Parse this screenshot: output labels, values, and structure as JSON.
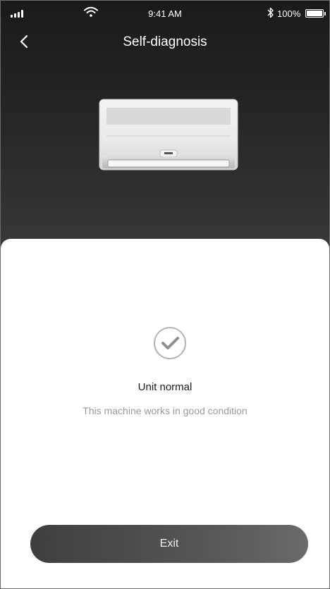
{
  "status_bar": {
    "time": "9:41 AM",
    "battery_percent": "100%",
    "icons": [
      "signal-icon",
      "wifi-icon",
      "bluetooth-icon",
      "battery-icon"
    ]
  },
  "header": {
    "title": "Self-diagnosis",
    "back_icon": "chevron-left-icon"
  },
  "illustration": {
    "name": "air-conditioner-unit"
  },
  "result": {
    "icon": "check-circle-icon",
    "title": "Unit normal",
    "description": "This machine works in good condition"
  },
  "footer": {
    "exit_label": "Exit"
  },
  "colors": {
    "header_bg_top": "#1a1a1a",
    "header_bg_bottom": "#3a3a3a",
    "button_bg": "#4a4a4a",
    "secondary_text": "#9a9a9a"
  }
}
